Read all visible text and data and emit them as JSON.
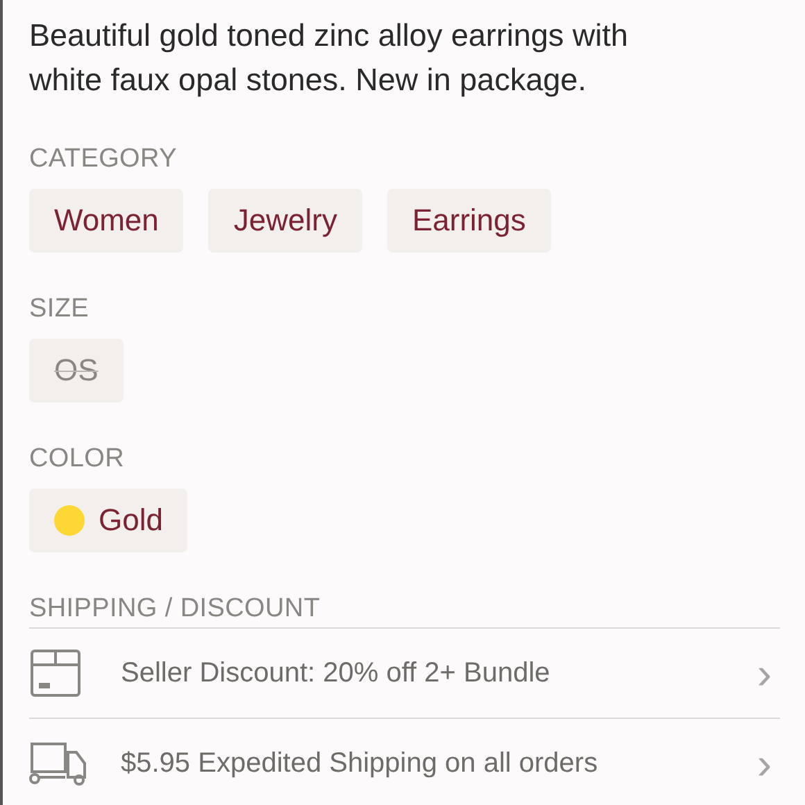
{
  "description": "Beautiful gold toned zinc alloy earrings with white faux opal stones. New in package.",
  "category": {
    "heading": "CATEGORY",
    "tags": [
      "Women",
      "Jewelry",
      "Earrings"
    ]
  },
  "size": {
    "heading": "SIZE",
    "options": [
      {
        "label": "OS",
        "available": false
      }
    ]
  },
  "color": {
    "heading": "COLOR",
    "options": [
      {
        "label": "Gold",
        "color": "#fdd835"
      }
    ]
  },
  "shipping": {
    "heading": "SHIPPING / DISCOUNT",
    "rows": [
      {
        "kind": "discount",
        "text": "Seller Discount: 20% off 2+ Bundle",
        "chevron": "›"
      },
      {
        "kind": "shipping",
        "text": "$5.95 Expedited Shipping on all orders",
        "chevron": "›"
      }
    ]
  }
}
